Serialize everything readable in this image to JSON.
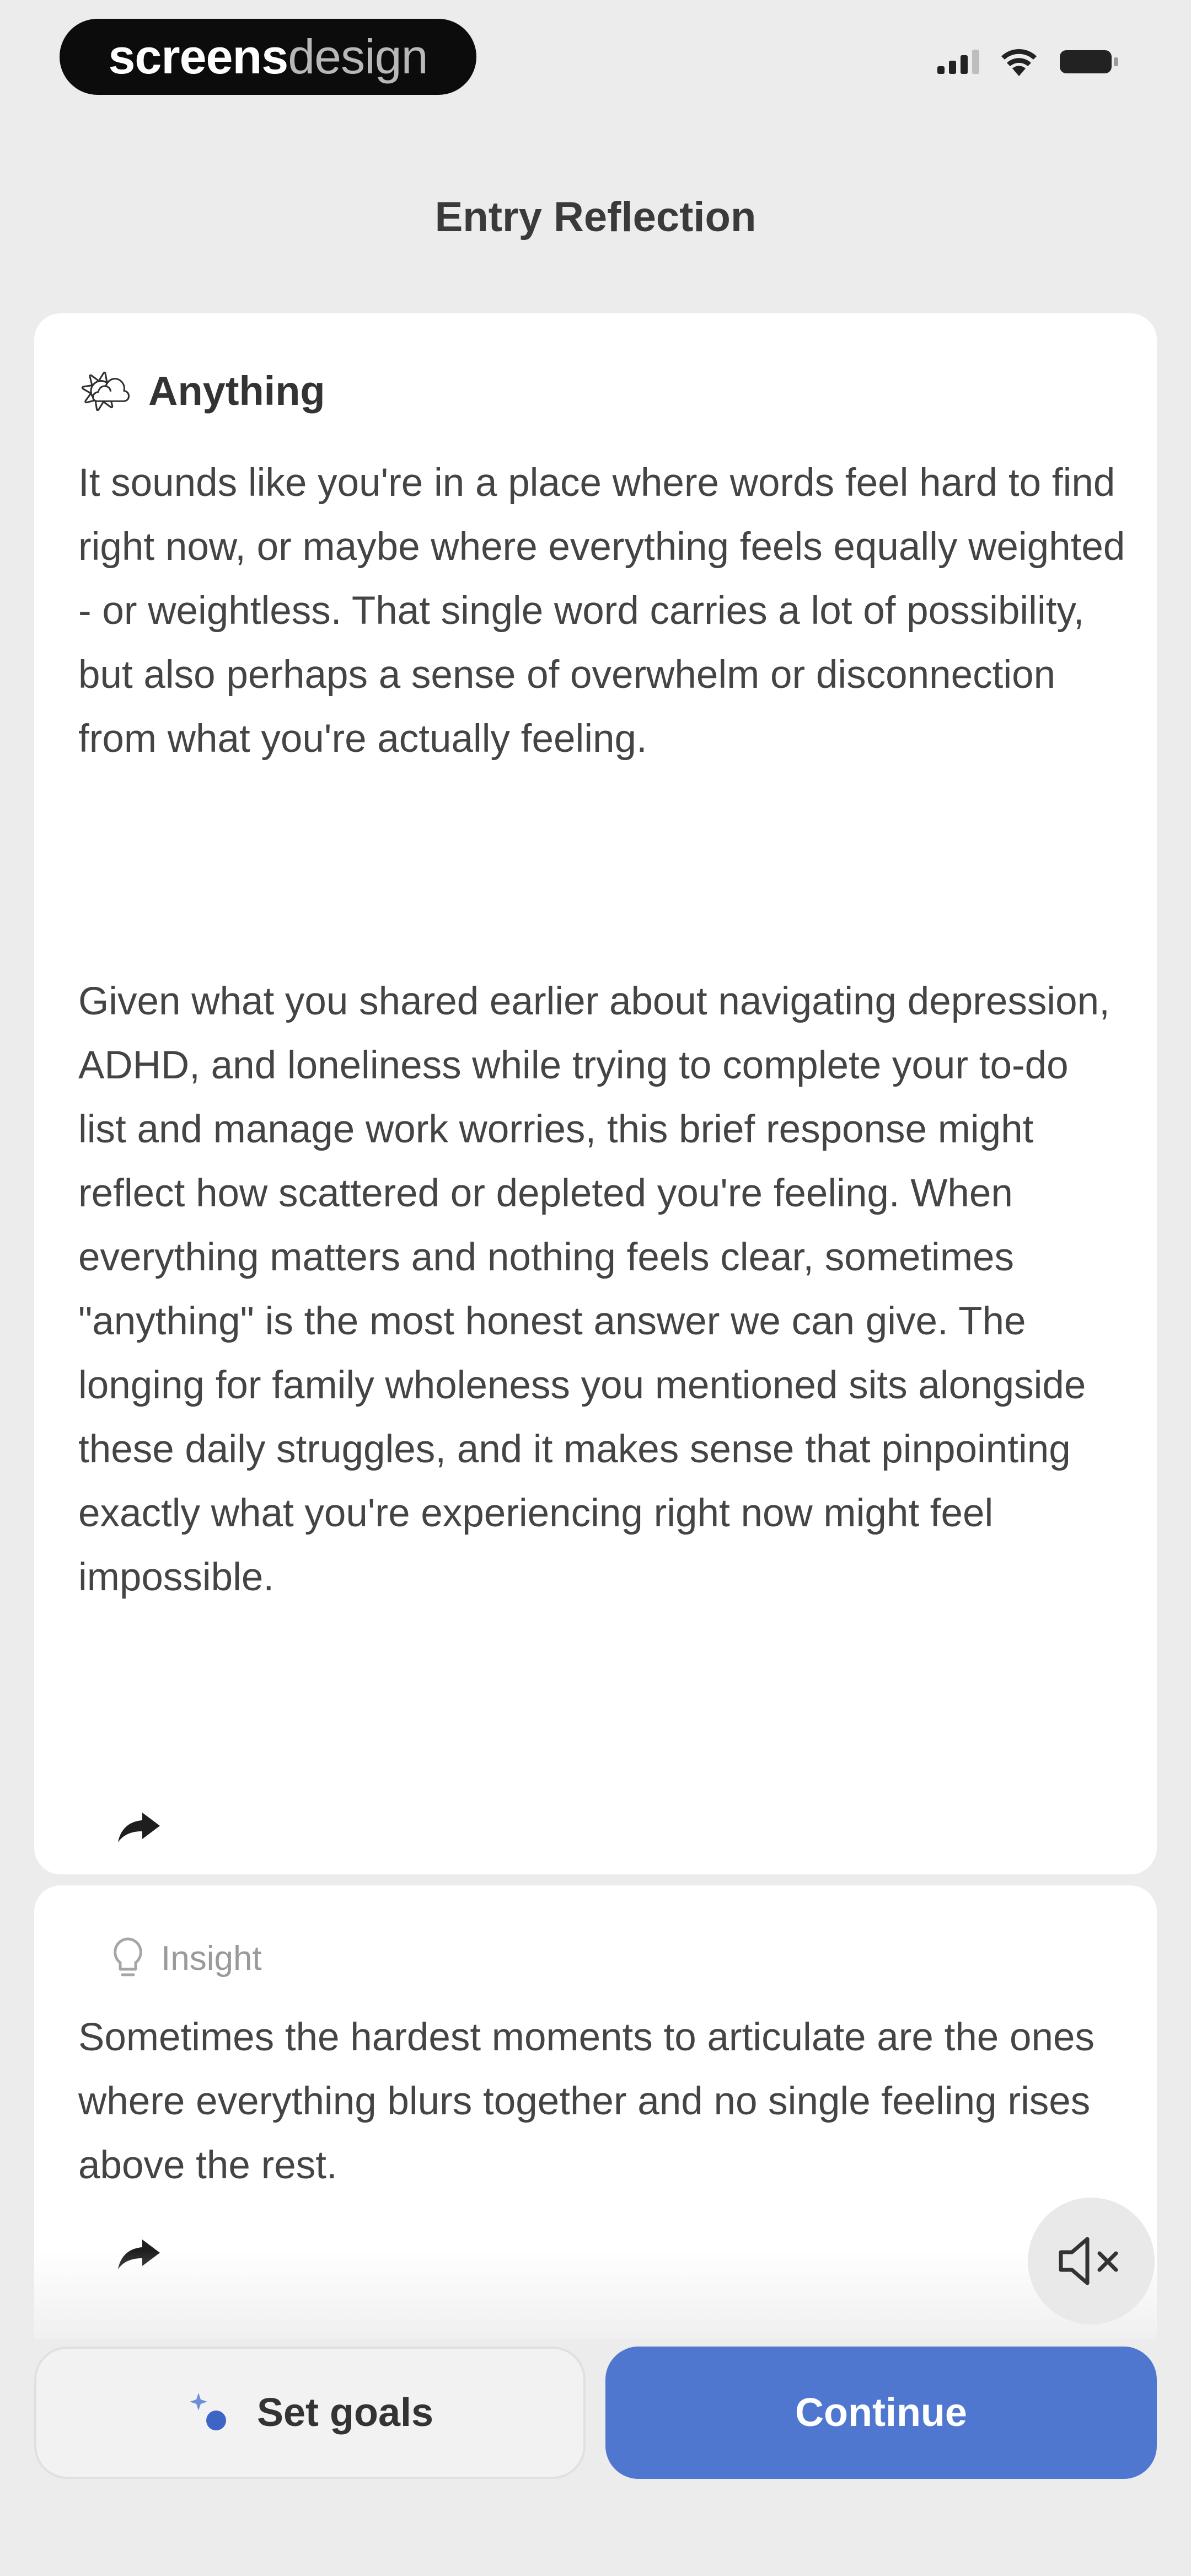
{
  "status_bar": {
    "watermark_bold": "screens",
    "watermark_light": "design",
    "icons": [
      "signal-icon",
      "wifi-icon",
      "battery-icon"
    ]
  },
  "header": {
    "title": "Entry Reflection"
  },
  "reflection": {
    "icon": "sun-behind-cloud-emoji",
    "emoji": "🌤",
    "heading": "Anything",
    "paragraph_1": "It sounds like you're in a place where words feel hard to find right now, or maybe where everything feels equally weighted - or weightless. That single word carries a lot of possibility, but also perhaps a sense of overwhelm or disconnection from what you're actually feeling.",
    "paragraph_2": "Given what you shared earlier about navigating depression, ADHD, and loneliness while trying to complete your to-do list and manage work worries, this brief response might reflect how scattered or depleted you're feeling. When everything matters and nothing feels clear, sometimes \"anything\" is the most honest answer we can give. The longing for family wholeness you mentioned sits alongside these daily struggles, and it makes sense that pinpointing exactly what you're experiencing right now might feel impossible.",
    "share_icon": "share-arrow-icon"
  },
  "insight": {
    "icon": "lightbulb-icon",
    "label": "Insight",
    "text": "Sometimes the hardest moments to articulate are the ones where everything blurs together and no single feeling rises above the rest.",
    "share_icon": "share-arrow-icon"
  },
  "audio": {
    "icon": "speaker-muted-icon"
  },
  "actions": {
    "goals_label": "Set goals",
    "goals_icon": "sparkle-icon",
    "continue_label": "Continue"
  },
  "colors": {
    "background": "#ececec",
    "card": "#ffffff",
    "primary": "#4f77cf",
    "text": "#444444",
    "muted": "#9a9a9a"
  }
}
